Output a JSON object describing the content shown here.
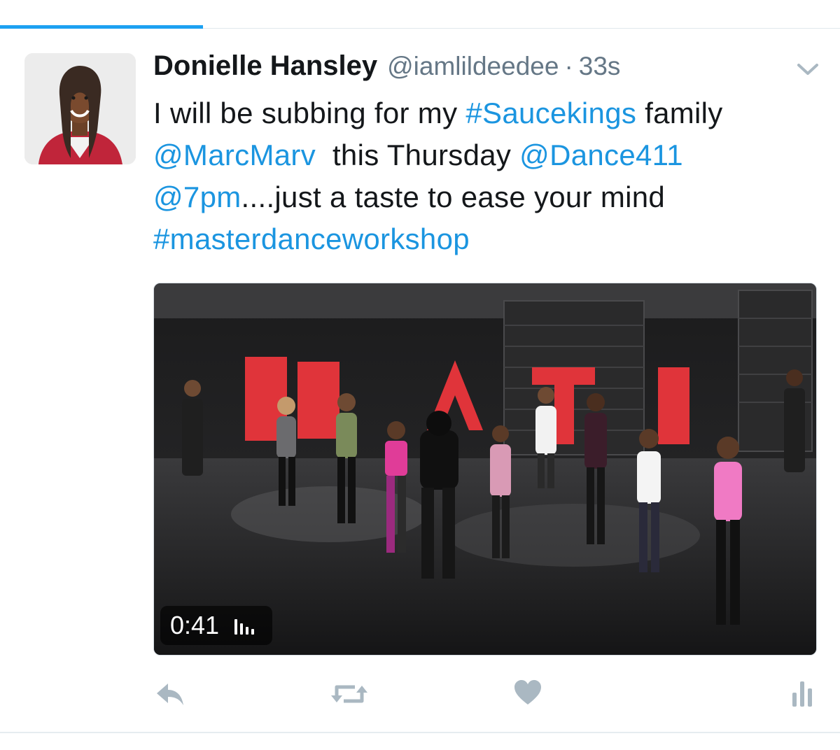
{
  "tweet": {
    "author_name": "Donielle Hansley",
    "handle": "@iamlildeedee",
    "separator": "·",
    "timestamp": "33s",
    "text_lines": {
      "l1a": "I will be subbing for my ",
      "l1b": "#Saucekings",
      "l1c": " family",
      "l2a": "@MarcMarv",
      "l2b": "  this Thursday ",
      "l2c": "@Dance411",
      "l3a": "@7pm",
      "l3b": "....just a taste to ease your mind",
      "l4a": "#masterdanceworkshop"
    },
    "video": {
      "duration": "0:41"
    }
  },
  "icons": {
    "caret": "chevron-down-icon",
    "reply": "reply-icon",
    "retweet": "retweet-icon",
    "like": "heart-icon",
    "analytics": "analytics-icon",
    "volume": "volume-bars-icon"
  },
  "colors": {
    "link": "#1b95e0",
    "accent": "#1da1f2",
    "secondary_text": "#657786",
    "action_icon": "#aab8c2"
  }
}
